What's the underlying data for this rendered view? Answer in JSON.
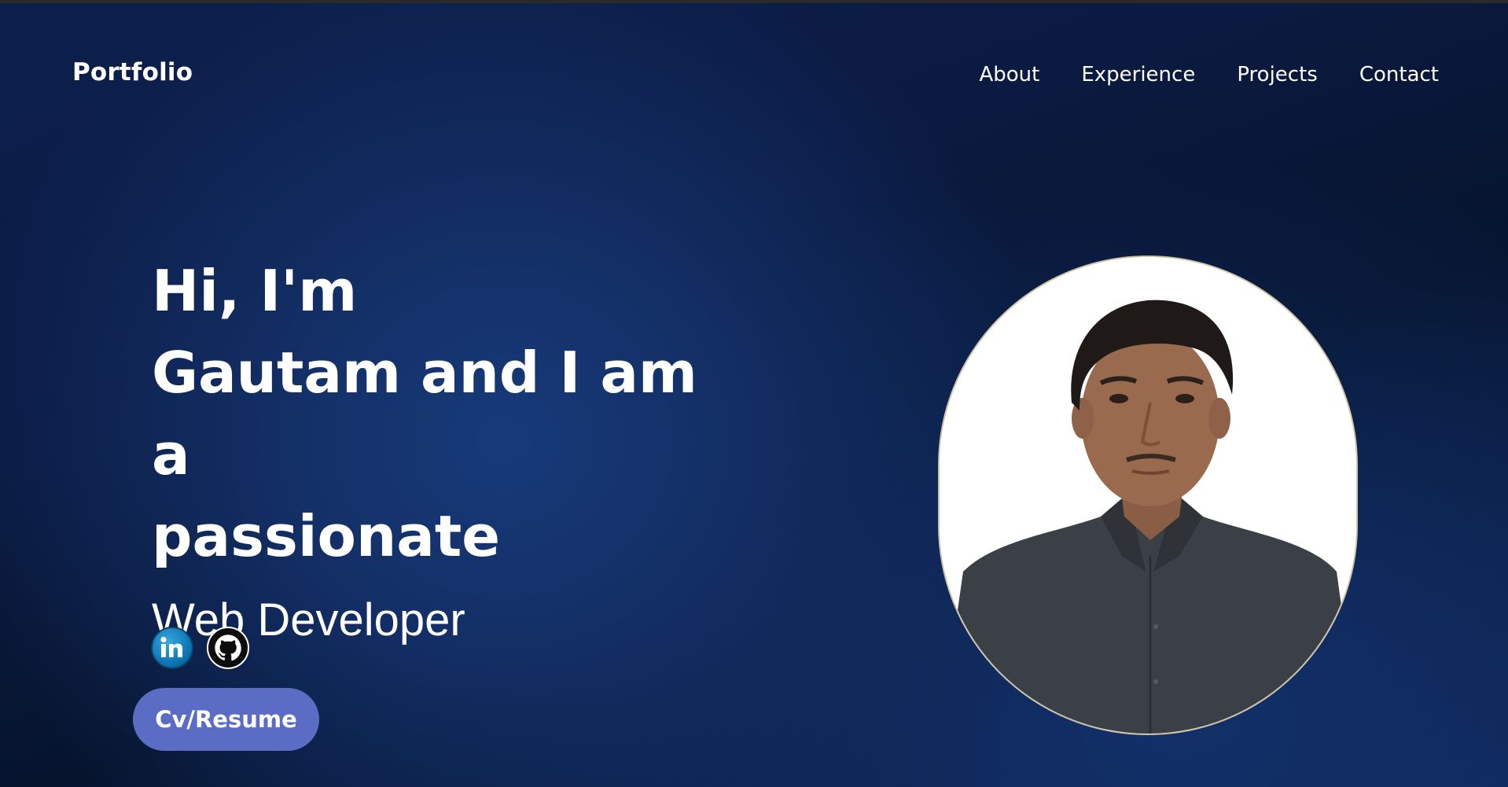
{
  "header": {
    "brand": "Portfolio",
    "nav": [
      "About",
      "Experience",
      "Projects",
      "Contact"
    ]
  },
  "hero": {
    "greeting_line1": "Hi, I'm",
    "greeting_line2": "Gautam and I am a",
    "greeting_line3": "passionate",
    "role": "Web Developer",
    "cv_label": "Cv/Resume"
  },
  "socials": [
    {
      "icon": "linkedin-icon"
    },
    {
      "icon": "github-icon"
    }
  ],
  "colors": {
    "background": "#0b1a40",
    "button": "#5b6cc4",
    "text": "#ffffff"
  }
}
